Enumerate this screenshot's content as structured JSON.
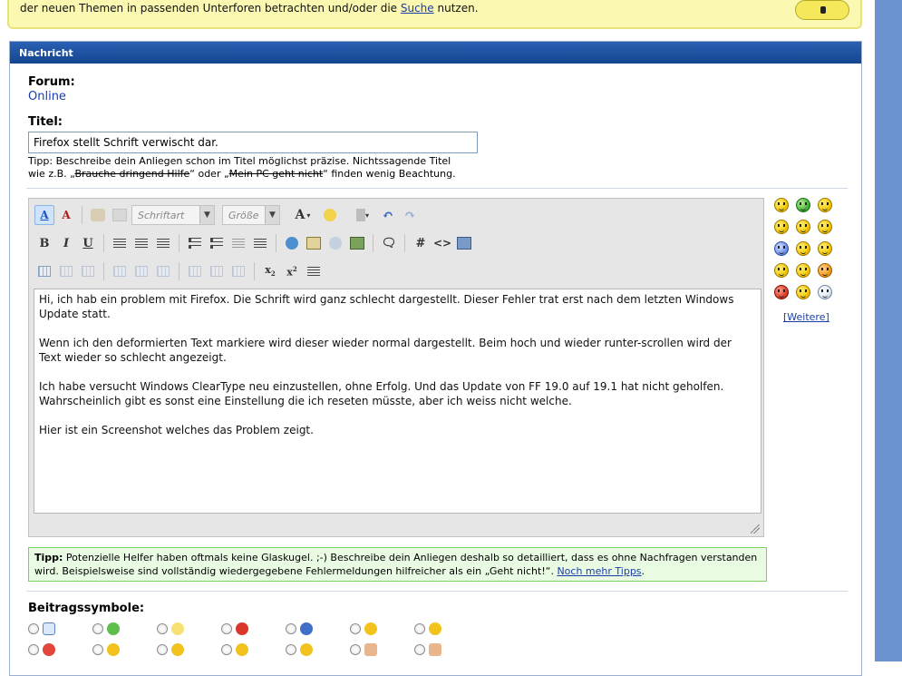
{
  "notice": {
    "text_before": "der neuen Themen in passenden Unterforen betrachten und/oder die ",
    "link": "Suche",
    "text_after": " nutzen."
  },
  "panel": {
    "title": "Nachricht",
    "forum_label": "Forum:",
    "forum_value": "Online",
    "title_label": "Titel:",
    "title_value": "Firefox stellt Schrift verwischt dar.",
    "title_tip_1": "Tipp: Beschreibe dein Anliegen schon im Titel möglichst präzise. Nichtssagende Titel",
    "title_tip_2a": "wie z.B. „",
    "title_tip_2b": "Brauche dringend Hilfe",
    "title_tip_2c": "“ oder „",
    "title_tip_2d": "Mein PC geht nicht",
    "title_tip_2e": "“ finden wenig Beachtung."
  },
  "editor": {
    "font_combo": "Schriftart",
    "size_combo": "Größe",
    "paragraphs": [
      "Hi, ich hab ein problem mit Firefox. Die Schrift wird ganz schlecht dargestellt. Dieser Fehler trat erst nach dem letzten Windows Update statt.",
      "Wenn ich den deformierten Text markiere wird dieser wieder normal dargestellt. Beim hoch und wieder runter-scrollen wird der Text wieder so schlecht angezeigt.",
      "Ich habe versucht Windows ClearType neu einzustellen, ohne Erfolg. Und das Update von FF 19.0 auf 19.1 hat nicht geholfen. Wahrscheinlich gibt es sonst eine Einstellung die ich reseten müsste, aber ich weiss nicht welche.",
      "Hier ist ein Screenshot welches das Problem zeigt."
    ]
  },
  "smilies": {
    "more_label": "[Weitere]"
  },
  "tip": {
    "label": "Tipp:",
    "text": " Potenzielle Helfer haben oftmals keine Glaskugel. ;-) Beschreibe dein Anliegen deshalb so detailliert, dass es ohne Nachfragen verstanden wird. Beispielsweise sind vollständig wiedergegebene Fehlermeldungen hilfreicher als ein „Geht nicht!“. ",
    "link": "Noch mehr Tipps",
    "end": "."
  },
  "symbols": {
    "label": "Beitragssymbole:"
  },
  "colors": {
    "header_blue": "#1f56a8",
    "tip_green_bg": "#eafbe4",
    "notice_yellow_bg": "#fbf8b2",
    "link_blue": "#1a3da8"
  }
}
